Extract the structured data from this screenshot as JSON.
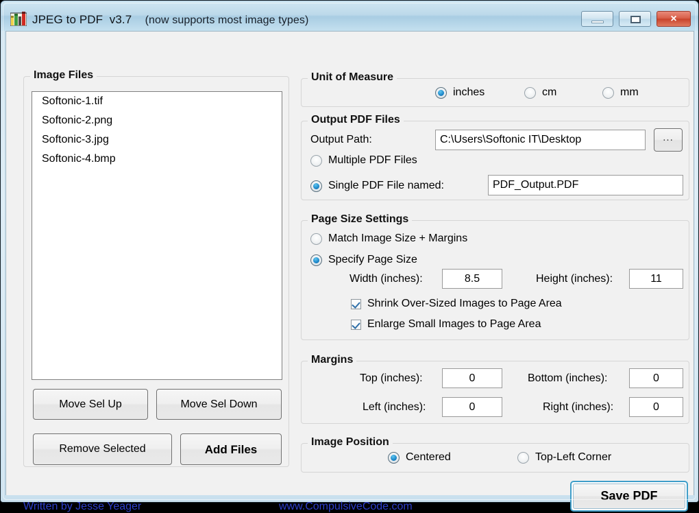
{
  "window": {
    "title": "JPEG to PDF",
    "version": "v3.7",
    "subtitle": "(now supports most image types)",
    "icon": "app-bars-icon",
    "controls": {
      "minimize": "minimize-icon",
      "maximize": "maximize-icon",
      "close": "×"
    },
    "accent_color": "#3f9ec9",
    "titlebar_color": "#bcd9ea",
    "close_button_color": "#c8432c"
  },
  "image_files": {
    "group_title": "Image Files",
    "files": [
      "Softonic-1.tif",
      "Softonic-2.png",
      "Softonic-3.jpg",
      "Softonic-4.bmp"
    ],
    "buttons": {
      "move_up": "Move Sel Up",
      "move_down": "Move Sel Down",
      "remove_selected": "Remove Selected",
      "add_files": "Add Files"
    }
  },
  "unit_of_measure": {
    "group_title": "Unit of Measure",
    "options": [
      {
        "label": "inches",
        "selected": true
      },
      {
        "label": "cm",
        "selected": false
      },
      {
        "label": "mm",
        "selected": false
      }
    ]
  },
  "output_pdf_files": {
    "group_title": "Output PDF Files",
    "output_path_label": "Output Path:",
    "output_path_value": "C:\\Users\\Softonic IT\\Desktop",
    "browse_button": "...",
    "multiple_label": "Multiple PDF Files",
    "multiple_selected": false,
    "single_label": "Single PDF File named:",
    "single_selected": true,
    "single_filename": "PDF_Output.PDF"
  },
  "page_size_settings": {
    "group_title": "Page Size Settings",
    "match_label": "Match Image Size + Margins",
    "match_selected": false,
    "specify_label": "Specify Page Size",
    "specify_selected": true,
    "width_label": "Width (inches):",
    "width_value": "8.5",
    "height_label": "Height (inches):",
    "height_value": "11",
    "shrink_label": "Shrink Over-Sized Images to Page Area",
    "shrink_checked": true,
    "enlarge_label": "Enlarge Small Images to Page Area",
    "enlarge_checked": true
  },
  "margins": {
    "group_title": "Margins",
    "top_label": "Top (inches):",
    "top_value": "0",
    "bottom_label": "Bottom (inches):",
    "bottom_value": "0",
    "left_label": "Left (inches):",
    "left_value": "0",
    "right_label": "Right (inches):",
    "right_value": "0"
  },
  "image_position": {
    "group_title": "Image Position",
    "options": [
      {
        "label": "Centered",
        "selected": true
      },
      {
        "label": "Top-Left Corner",
        "selected": false
      }
    ]
  },
  "footer": {
    "author": "Written by Jesse Yeager",
    "website": "www.CompulsiveCode.com",
    "save_button": "Save PDF",
    "link_color": "#2d3fcb"
  }
}
